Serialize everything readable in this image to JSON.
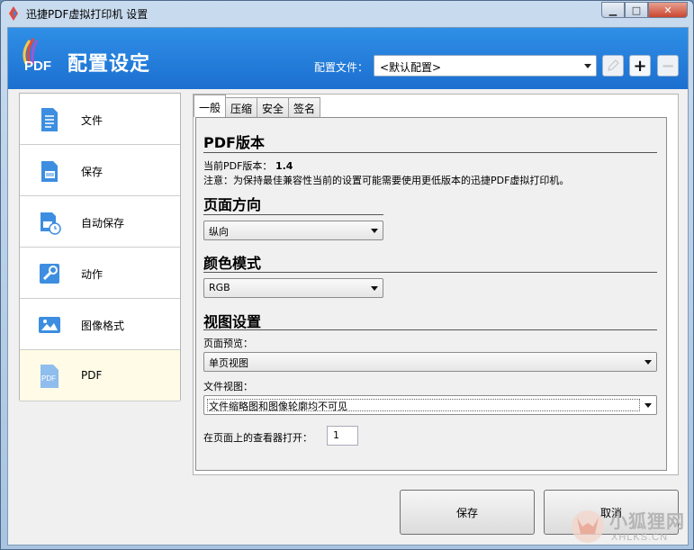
{
  "window": {
    "title": "迅捷PDF虚拟打印机 设置"
  },
  "header": {
    "logo_text": "PDF",
    "title": "配置设定",
    "profile_label": "配置文件：",
    "profile_value": "<默认配置>",
    "add_symbol": "+",
    "remove_symbol": "−"
  },
  "sidebar": {
    "items": [
      {
        "label": "文件",
        "icon": "document-icon"
      },
      {
        "label": "保存",
        "icon": "save-icon"
      },
      {
        "label": "自动保存",
        "icon": "autosave-icon"
      },
      {
        "label": "动作",
        "icon": "wrench-icon"
      },
      {
        "label": "图像格式",
        "icon": "image-icon"
      },
      {
        "label": "PDF",
        "icon": "pdf-icon",
        "active": true
      }
    ]
  },
  "tabs": [
    "一般",
    "压缩",
    "安全",
    "签名"
  ],
  "general": {
    "pdf_version_title": "PDF版本",
    "current_version_label": "当前PDF版本：",
    "current_version_value": "1.4",
    "note": "注意：为保持最佳兼容性当前的设置可能需要使用更低版本的迅捷PDF虚拟打印机。",
    "orientation_title": "页面方向",
    "orientation_value": "纵向",
    "color_title": "颜色模式",
    "color_value": "RGB",
    "view_title": "视图设置",
    "page_preview_label": "页面预览：",
    "page_preview_value": "单页视图",
    "document_view_label": "文件视图：",
    "document_view_value": "文件缩略图和图像轮廓均不可见",
    "open_page_label": "在页面上的查看器打开：",
    "open_page_value": "1"
  },
  "buttons": {
    "save": "保存",
    "cancel": "取消"
  },
  "watermark": {
    "text": "小狐狸网",
    "sub": "XHLKS.CN"
  }
}
